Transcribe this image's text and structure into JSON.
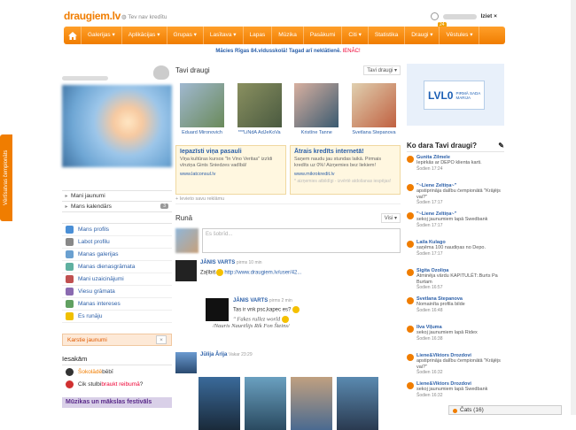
{
  "header": {
    "logo": "draugiem.lv",
    "credit": "Tev nav kredītu",
    "logout": "Iziet ×"
  },
  "nav": {
    "items": [
      "Galerijas ▾",
      "Aplikācijas ▾",
      "Grupas ▾",
      "Lasītava ▾",
      "Lapas",
      "Mūzika",
      "Pasākumi",
      "Citi ▾",
      "Statistika",
      "Draugi ▾",
      "Vēstules ▾"
    ],
    "badge": "24"
  },
  "promo": {
    "lead": "Mācies Rīgas 84.vidusskolā! Tagad arī neklātienē.",
    "cta": "IENĀC!"
  },
  "sidetab": "Vērtīsatvas čempionāts",
  "left": {
    "menu1": [
      {
        "label": "Mani jaunumi"
      },
      {
        "label": "Mans kalendārs",
        "count": "3"
      }
    ],
    "menu2": [
      {
        "label": "Mans profils",
        "color": "#4a8fd6"
      },
      {
        "label": "Labot profilu",
        "color": "#888"
      },
      {
        "label": "Manas galerijas",
        "color": "#6aa0d0"
      },
      {
        "label": "Manas dienasgrāmata",
        "color": "#5fb0a0"
      },
      {
        "label": "Mani uzaicinājumi",
        "color": "#c05050"
      },
      {
        "label": "Viesu grāmata",
        "color": "#8a6ab0"
      },
      {
        "label": "Manas intereses",
        "color": "#60a060"
      },
      {
        "label": "Es runāju",
        "color": "#f0c000"
      }
    ],
    "karstie": "Karstie jaunumi",
    "iesakam": "Iesakām",
    "rec": [
      {
        "pre": "",
        "link": "Šokolādē",
        "post": " bēbī"
      },
      {
        "pre": "Cik stulbi ",
        "link": "braukt reibumā",
        "post": "?"
      }
    ],
    "festival": "Mūzikas un mākslas festivāls"
  },
  "center": {
    "friends_title": "Tavi draugi",
    "friends_select": "Tavi draugi ▾",
    "friends": [
      {
        "name": "Eduard Mironovich",
        "c1": "#6a8a5a",
        "c2": "#a0b8d0"
      },
      {
        "name": "***LiNdA AdJeKoVa",
        "c1": "#4a5a40",
        "c2": "#8a9060"
      },
      {
        "name": "Kristīne Tanne",
        "c1": "#3a5a70",
        "c2": "#d8b0a0"
      },
      {
        "name": "Svetlana Stepanova",
        "c1": "#c06040",
        "c2": "#e0d0b0"
      }
    ],
    "ads": [
      {
        "title": "Iepazīsti viņa pasauli",
        "desc": "Viņa kultūras kursos \"In Vino Veritas\" izzīdi vīnziņa Gints Sniedzes vadībā!",
        "url": "www.latconsul.lv",
        "votes": ""
      },
      {
        "title": "Ātrais kredīts internetā!",
        "desc": "Saņem naudu jau stundas laikā. Pirmais kredīts uz 0%! Aizņemies bez liekiem!",
        "url": "www.mikrokredit.lv",
        "votes": "* aizņemies atbildīgi - izvērtē atdošanas iespējas!"
      }
    ],
    "ad_note": "+ Ievieto savu reklāmu",
    "runa_title": "Runā",
    "runa_select": "Visi ▾",
    "composer_placeholder": "Es šobrīd...",
    "posts": [
      {
        "name": "JĀNIS VARTS",
        "time": "pirms 10 min",
        "text": "Zaļībiš",
        "link": "http://www.draugiem.lv/user/42..."
      }
    ],
    "reply": {
      "name": "JĀNIS VARTS",
      "time": "pirms 2 min",
      "text": "Tas ir vnk psc,kapec es?",
      "quote1": "Fakes rullez world",
      "quote2": "/Nauris Naurēlijs Rik Fon Šteins/"
    },
    "post3": {
      "name": "Jūlija Ārija",
      "time": "Vakar 23:29"
    },
    "gallery": [
      {
        "c1": "#3a6a9a",
        "c2": "#1a2a3a"
      },
      {
        "c1": "#6aa0c0",
        "c2": "#2a4a60"
      },
      {
        "c1": "#c0a080",
        "c2": "#4a6a90"
      },
      {
        "c1": "#5a8ab0",
        "c2": "#2a3a50"
      }
    ]
  },
  "right": {
    "ad": {
      "lv": "LVL0",
      "small": "PIRMĀ SADA MARIJA"
    },
    "kdt_title": "Ko dara Tavi draugi?",
    "activities": [
      {
        "name": "Gunita Zilmele",
        "desc": "Iepirkās ar DEPO klienta karti.",
        "time": "Šodien 17:24"
      },
      {
        "name": "\"~Liene Zeltiņa~\"",
        "desc": "apstiprināja dalību čempionātā \"Krājējs vai?\"",
        "time": "Šodien 17:17"
      },
      {
        "name": "\"~Liene Zeltiņa~\"",
        "desc": "sekoj jaunumiem lapā Swedbank",
        "time": "Šodien 17:17"
      },
      {
        "name": "Laila Kulago",
        "desc": "saņēma 100 naudiņas no Depo.",
        "time": "Šodien 17:17"
      },
      {
        "name": "Sigita Ozoliņa",
        "desc": "Atminēja vārdu KAPITULĒT:.Burts Pa Burtam",
        "time": "Šodien 16:57"
      },
      {
        "name": "Svetlana Stepanova",
        "desc": "Nomainīta profila bilde",
        "time": "Šodien 16:48"
      },
      {
        "name": "Ilva Viļuma",
        "desc": "sekoj jaunumiem lapā Ridex",
        "time": "Šodien 16:38"
      },
      {
        "name": "Liene&Viktors Drozdovi",
        "desc": "apstiprināja dalību čempionātā \"Krājējs vai?\"",
        "time": "Šodien 16:32"
      },
      {
        "name": "Liene&Viktors Drozdovi",
        "desc": "sekoj jaunumiem lapā Swedbank",
        "time": "Šodien 16:32"
      }
    ],
    "chat": "Čats (16)"
  }
}
